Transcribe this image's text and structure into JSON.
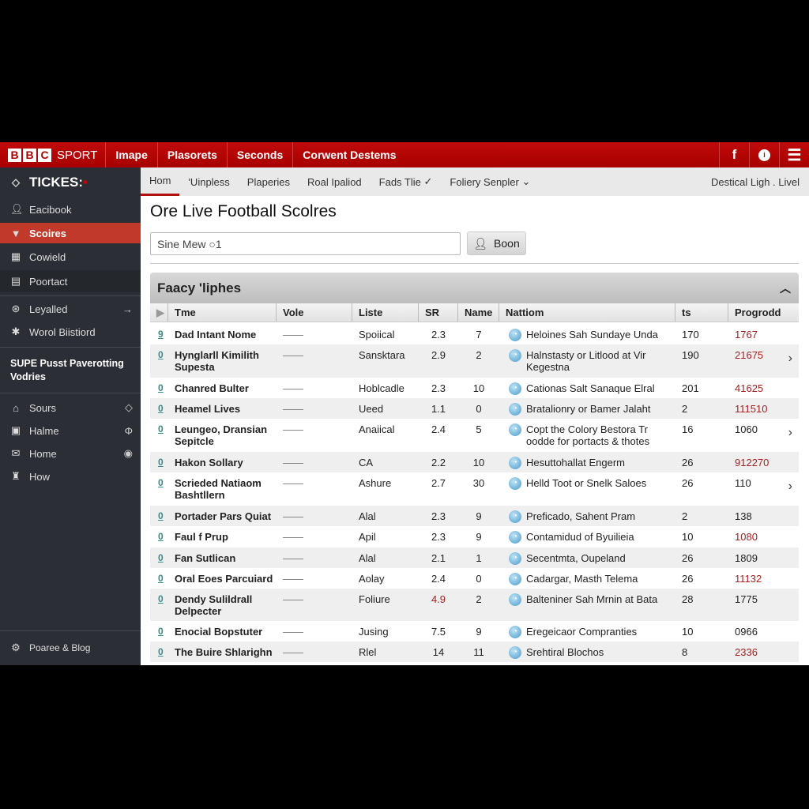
{
  "topbar": {
    "logo_letters": [
      "B",
      "B",
      "C"
    ],
    "logo_sport": "SPORT",
    "nav": [
      "Imape",
      "Plasorets",
      "Seconds",
      "Corwent Destems"
    ],
    "icons": [
      "facebook-icon",
      "info-icon",
      "menu-icon"
    ]
  },
  "sidebar": {
    "brand": "TICKES:",
    "items": [
      {
        "label": "Eacibook",
        "icon": "user-icon"
      },
      {
        "label": "Scoires",
        "icon": "trophy-icon",
        "active": true
      },
      {
        "label": "Cowield",
        "icon": "grid-icon"
      },
      {
        "label": "Poortact",
        "icon": "doc-icon"
      },
      {
        "label": "Leyalled",
        "icon": "ball-icon"
      },
      {
        "label": "Worol Biistiord",
        "icon": "splash-icon"
      }
    ],
    "promo": "SUPE Pusst Paverotting Vodries",
    "items2": [
      {
        "label": "Sours",
        "icon": "home-icon"
      },
      {
        "label": "Halme",
        "icon": "building-icon"
      },
      {
        "label": "Home",
        "icon": "mail-icon"
      },
      {
        "label": "How",
        "icon": "trophy-icon"
      }
    ],
    "footer": "Poaree & Blog"
  },
  "subnav": {
    "tabs": [
      "Hom",
      "'Uinpless",
      "Plaperies",
      "Roal Ipaliod",
      "Fads Tlie",
      "Foliery Senpler"
    ],
    "right": "Destical Ligh . Livel"
  },
  "main": {
    "title": "Ore Live Football Scolres",
    "search_value": "Sine Mew ○1",
    "button_label": "Boon",
    "panel_title": "Faacy 'liphes"
  },
  "table": {
    "columns": [
      "Tme",
      "Vole",
      "Liste",
      "SR",
      "Name",
      "Nattiom",
      "ts",
      "Progrodd"
    ],
    "rows": [
      {
        "mark": "9",
        "name": "Dad Intant Nome",
        "vole": "——",
        "liste": "Spoiical",
        "sr": "2.3",
        "nm": "7",
        "nation": "Heloines Sah Sundaye Unda",
        "ts": "170",
        "prog": "1767",
        "prog_red": true
      },
      {
        "mark": "0",
        "name": "Hynglarll Kimilith Supesta",
        "vole": "——",
        "liste": "Sansktara",
        "sr": "2.9",
        "nm": "2",
        "nation": "Halnstasty or Litlood at Vir Kegestna",
        "ts": "190",
        "prog": "21675",
        "prog_red": true,
        "chevron": true
      },
      {
        "mark": "0",
        "name": "Chanred Bulter",
        "vole": "——",
        "liste": "Hoblcadle",
        "sr": "2.3",
        "nm": "10",
        "nation": "Cationas Salt Sanaque Elral",
        "ts": "201",
        "prog": "41625",
        "prog_red": true
      },
      {
        "mark": "0",
        "name": "Heamel Lives",
        "vole": "——",
        "liste": "Ueed",
        "sr": "1.1",
        "nm": "0",
        "nation": "Bratalionry or Bamer Jalaht",
        "ts": "2",
        "prog": "111510",
        "prog_red": true
      },
      {
        "mark": "0",
        "name": "Leungeo, Dransian Sepitcle",
        "vole": "——",
        "liste": "Anaiical",
        "sr": "2.4",
        "nm": "5",
        "nation": "Copt the Colory Bestora Tr oodde for portacts & thotes",
        "ts": "16",
        "prog": "1060",
        "chevron": true
      },
      {
        "mark": "0",
        "name": "Hakon Sollary",
        "vole": "——",
        "liste": "CA",
        "sr": "2.2",
        "nm": "10",
        "nation": "Hesuttohallat Engerm",
        "ts": "26",
        "prog": "912270",
        "prog_red": true
      },
      {
        "mark": "0",
        "name": "Scrieded Natiaom Bashtllern",
        "vole": "——",
        "liste": "Ashure",
        "sr": "2.7",
        "nm": "30",
        "nation": "Helld Toot or Snelk Saloes",
        "ts": "26",
        "prog": "110",
        "chevron": true
      },
      {
        "mark": "0",
        "name": "Portader Pars Quiat",
        "vole": "——",
        "liste": "Alal",
        "sr": "2.3",
        "nm": "9",
        "nation": "Preficado, Sahent Pram",
        "ts": "2",
        "prog": "138"
      },
      {
        "mark": "0",
        "name": "Faul f Prup",
        "vole": "——",
        "liste": "Apil",
        "sr": "2.3",
        "nm": "9",
        "nation": "Contamidud of Byuilieia",
        "ts": "10",
        "prog": "1080",
        "prog_red": true
      },
      {
        "mark": "0",
        "name": "Fan Sutlican",
        "vole": "——",
        "liste": "Alal",
        "sr": "2.1",
        "nm": "1",
        "nation": "Secentmta, Oupeland",
        "ts": "26",
        "prog": "1809"
      },
      {
        "mark": "0",
        "name": "Oral Eoes Parcuiard",
        "vole": "——",
        "liste": "Aolay",
        "sr": "2.4",
        "nm": "0",
        "nation": "Cadargar, Masth Telema",
        "ts": "26",
        "prog": "11132",
        "prog_red": true
      },
      {
        "mark": "0",
        "name": "Dendy Sulildrall Delpecter",
        "vole": "——",
        "liste": "Foliure",
        "sr": "4.9",
        "sr_red": true,
        "nm": "2",
        "nation": "Balteniner Sah Mrnin at Bata",
        "ts": "28",
        "prog": "1775"
      },
      {
        "mark": "0",
        "name": "Enocial Bopstuter",
        "vole": "——",
        "liste": "Jusing",
        "sr": "7.5",
        "nm": "9",
        "nation": "Eregeicaor Compranties",
        "ts": "10",
        "prog": "0966"
      },
      {
        "mark": "0",
        "name": "The Buire Shlarighn",
        "vole": "——",
        "liste": "Rlel",
        "sr": "14",
        "nm": "11",
        "nation": "Srehtiral Blochos",
        "ts": "8",
        "prog": "2336",
        "prog_red": true
      }
    ]
  },
  "colors": {
    "brand_red": "#b00000",
    "sidebar_bg": "#2b2e34",
    "active_item": "#c0392b",
    "value_red": "#a82020"
  }
}
